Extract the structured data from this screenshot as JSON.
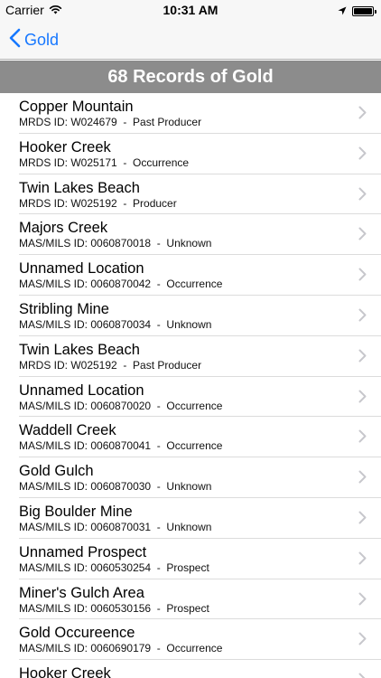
{
  "status_bar": {
    "carrier": "Carrier",
    "time": "10:31 AM",
    "icons": [
      "wifi-icon",
      "location-arrow-icon",
      "battery-icon"
    ]
  },
  "nav": {
    "back_label": "Gold",
    "back_icon": "chevron-left-icon",
    "accent_color": "#1677ff"
  },
  "header": {
    "title": "68 Records of Gold",
    "background_color": "#8c8c8c"
  },
  "records": [
    {
      "name": "Copper Mountain",
      "detail": "MRDS ID: W024679  -  Past Producer"
    },
    {
      "name": "Hooker Creek",
      "detail": "MRDS ID: W025171  -  Occurrence"
    },
    {
      "name": "Twin Lakes Beach",
      "detail": "MRDS ID: W025192  -  Producer"
    },
    {
      "name": "Majors Creek",
      "detail": "MAS/MILS ID: 0060870018  -  Unknown"
    },
    {
      "name": "Unnamed Location",
      "detail": "MAS/MILS ID: 0060870042  -  Occurrence"
    },
    {
      "name": "Stribling Mine",
      "detail": "MAS/MILS ID: 0060870034  -  Unknown"
    },
    {
      "name": "Twin Lakes Beach",
      "detail": "MRDS ID: W025192  -  Past Producer"
    },
    {
      "name": "Unnamed Location",
      "detail": "MAS/MILS ID: 0060870020  -  Occurrence"
    },
    {
      "name": "Waddell Creek",
      "detail": "MAS/MILS ID: 0060870041  -  Occurrence"
    },
    {
      "name": "Gold Gulch",
      "detail": "MAS/MILS ID: 0060870030  -  Unknown"
    },
    {
      "name": "Big Boulder Mine",
      "detail": "MAS/MILS ID: 0060870031  -  Unknown"
    },
    {
      "name": "Unnamed Prospect",
      "detail": "MAS/MILS ID: 0060530254  -  Prospect"
    },
    {
      "name": "Miner's Gulch Area",
      "detail": "MAS/MILS ID: 0060530156  -  Prospect"
    },
    {
      "name": "Gold Occureence",
      "detail": "MAS/MILS ID: 0060690179  -  Occurrence"
    },
    {
      "name": "Hooker Creek",
      "detail": ""
    }
  ]
}
